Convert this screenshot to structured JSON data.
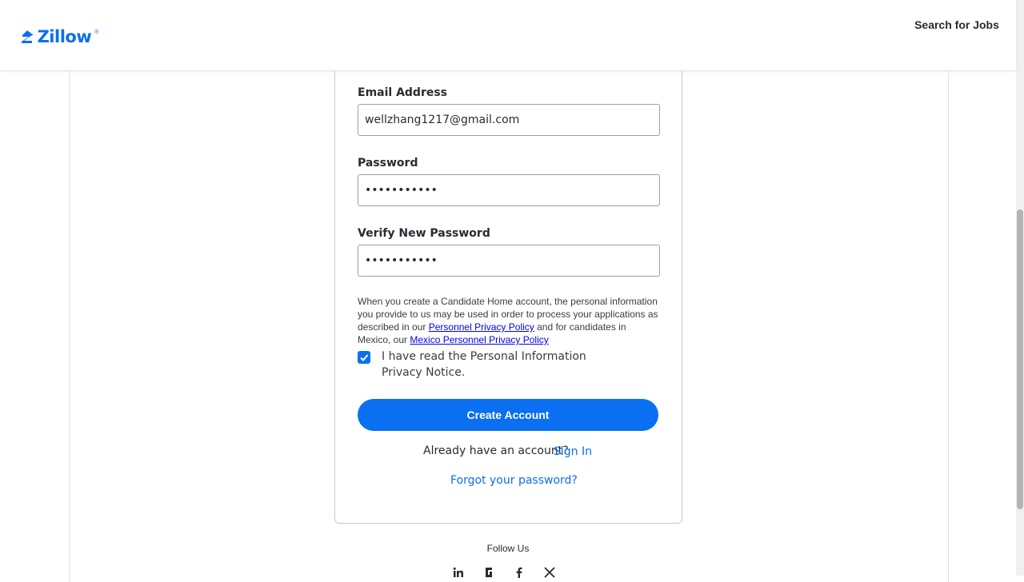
{
  "header": {
    "logo_text": "Zillow",
    "logo_registered": "®",
    "search_jobs": "Search for Jobs"
  },
  "form": {
    "email_label": "Email Address",
    "email_value": "wellzhang1217@gmail.com",
    "password_label": "Password",
    "password_value": "•••••••••••",
    "verify_label": "Verify New Password",
    "verify_value": "•••••••••••",
    "notice_text_1": "When you create a Candidate Home account, the personal information you provide to us may be used in order to process your applications as described in our ",
    "notice_link_1": "Personnel Privacy Policy",
    "notice_text_2": " and for candidates in Mexico, our ",
    "notice_link_2": "Mexico Personnel Privacy Policy",
    "checkbox_checked": true,
    "checkbox_label": "I have read the Personal Information Privacy Notice.",
    "create_button": "Create Account",
    "already_text": "Already have an account?",
    "sign_in": "Sign In",
    "forgot": "Forgot your password?"
  },
  "footer": {
    "follow_us": "Follow Us",
    "social_icons": [
      "linkedin-icon",
      "glassdoor-icon",
      "facebook-icon",
      "x-icon"
    ]
  },
  "colors": {
    "brand": "#0a6ff0",
    "text": "#2a2a33",
    "link": "#0000ee"
  }
}
